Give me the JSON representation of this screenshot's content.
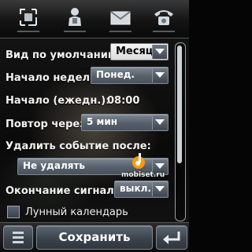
{
  "tabs": [
    {
      "icon": "view-frame-icon"
    },
    {
      "icon": "contacts-icon"
    },
    {
      "icon": "message-icon"
    },
    {
      "icon": "phone-icon"
    }
  ],
  "settings": {
    "default_view": {
      "label": "Вид по умолчанию:",
      "value": "Месяц"
    },
    "week_start": {
      "label": "Начало недели:",
      "value": "Понед."
    },
    "daily_start": {
      "label": "Начало (ежедн.):",
      "value": "08:00"
    },
    "repeat_after": {
      "label": "Повтор через:",
      "value": "5 мин"
    },
    "delete_event": {
      "label": "Удалить событие после:",
      "value": "Не удалять"
    },
    "signal_end": {
      "label": "Окончание сигнала:",
      "value": "выкл."
    },
    "lunar_calendar": {
      "label": "Лунный календарь",
      "checked": false
    }
  },
  "watermark": "mobiset.ru",
  "bottom_bar": {
    "save_label": "Сохранить"
  }
}
